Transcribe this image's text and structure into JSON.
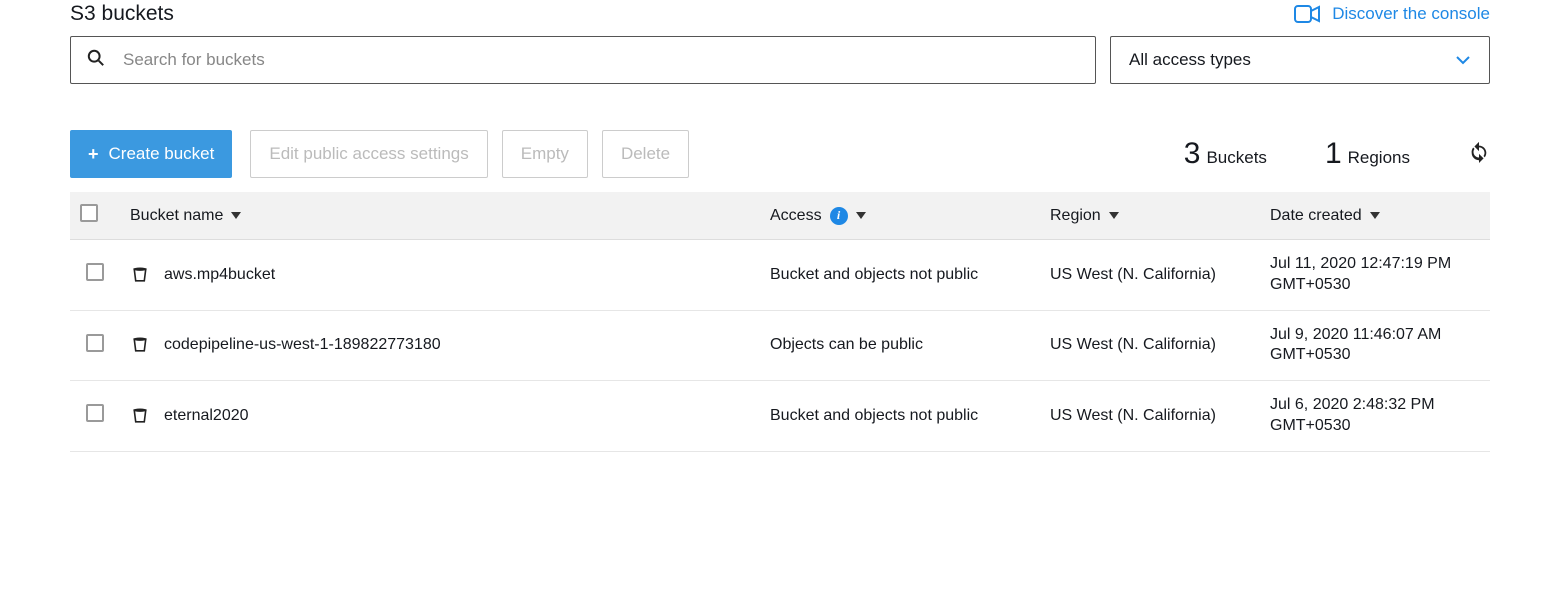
{
  "header": {
    "title": "S3 buckets",
    "discover_label": "Discover the console"
  },
  "search": {
    "placeholder": "Search for buckets"
  },
  "access_filter": {
    "selected": "All access types"
  },
  "toolbar": {
    "create_label": "Create bucket",
    "edit_label": "Edit public access settings",
    "empty_label": "Empty",
    "delete_label": "Delete"
  },
  "stats": {
    "buckets_count": "3",
    "buckets_label": "Buckets",
    "regions_count": "1",
    "regions_label": "Regions"
  },
  "columns": {
    "name": "Bucket name",
    "access": "Access",
    "region": "Region",
    "date": "Date created"
  },
  "rows": [
    {
      "name": "aws.mp4bucket",
      "access": "Bucket and objects not public",
      "region": "US West (N. California)",
      "date": "Jul 11, 2020 12:47:19 PM GMT+0530"
    },
    {
      "name": "codepipeline-us-west-1-189822773180",
      "access": "Objects can be public",
      "region": "US West (N. California)",
      "date": "Jul 9, 2020 11:46:07 AM GMT+0530"
    },
    {
      "name": "eternal2020",
      "access": "Bucket and objects not public",
      "region": "US West (N. California)",
      "date": "Jul 6, 2020 2:48:32 PM GMT+0530"
    }
  ]
}
